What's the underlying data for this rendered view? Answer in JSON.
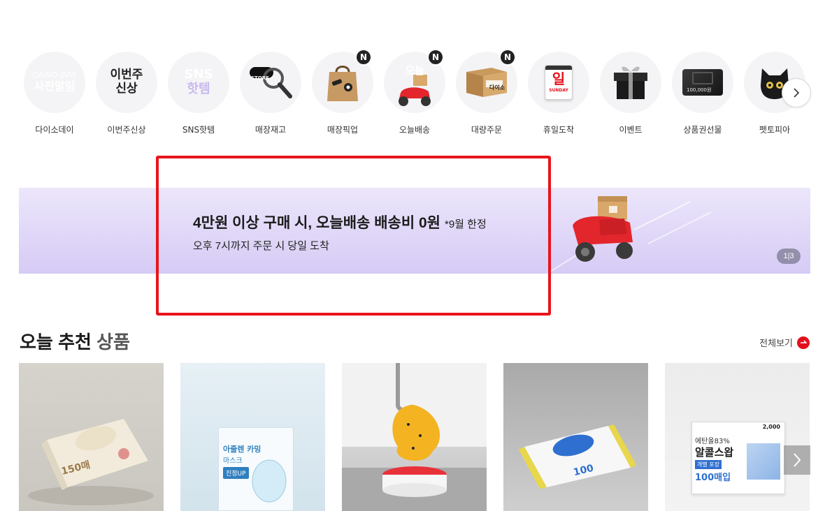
{
  "categories": [
    {
      "label": "다이소데이",
      "circle_line1": "DAISO-DAY",
      "circle_line2": "사전알림",
      "badge": ""
    },
    {
      "label": "이번주신상",
      "circle_line1": "이번주",
      "circle_line2": "신상",
      "badge": ""
    },
    {
      "label": "SNS핫템",
      "circle_line1": "SNS",
      "circle_line2": "핫템",
      "badge": ""
    },
    {
      "label": "매장재고",
      "circle_line1": "STORE",
      "icon": "magnifier-icon",
      "badge": ""
    },
    {
      "label": "매장픽업",
      "icon": "shopping-bag-icon",
      "badge": "N"
    },
    {
      "label": "오늘배송",
      "circle_line1": "오늘",
      "icon": "delivery-scooter-icon",
      "badge": "N"
    },
    {
      "label": "대량주문",
      "circle_line1": "다이소",
      "icon": "box-icon",
      "badge": "N"
    },
    {
      "label": "휴일도착",
      "circle_line1": "일",
      "circle_line2": "SUNDAY",
      "icon": "calendar-icon",
      "badge": ""
    },
    {
      "label": "이벤트",
      "icon": "gift-box-icon",
      "badge": ""
    },
    {
      "label": "상품권선물",
      "circle_line1": "100,000원",
      "icon": "gift-card-icon",
      "badge": ""
    },
    {
      "label": "펫토피아",
      "icon": "black-cat-icon",
      "badge": ""
    }
  ],
  "banner": {
    "title": "4만원 이상 구매 시, 오늘배송 배송비 0원",
    "note": "*9월 한정",
    "subtitle": "오후 7시까지 주문 시 당일 도착",
    "pager": "1|3"
  },
  "section": {
    "title_main": "오늘 추천",
    "title_accent": "상품",
    "view_all": "전체보기"
  },
  "products": [
    {
      "name": "wet-wipes-pack",
      "label_big": "150매"
    },
    {
      "name": "collagen-mask",
      "label_top": "아줄렌 카밍",
      "label_mid": "마스크",
      "label_btn": "진정UP"
    },
    {
      "name": "fly-trap",
      "label_big": ""
    },
    {
      "name": "wet-wipes-blue",
      "label_big": "100"
    },
    {
      "name": "alcohol-swab",
      "label_top": "에탄올83%",
      "label_mid": "알콜스왑",
      "label_btn": "개별 포장",
      "label_big": "100매입",
      "price": "2,000"
    }
  ],
  "colors": {
    "accent": "#e3101b",
    "highlight": "#e8141c",
    "banner_top": "#ece6fb",
    "banner_bottom": "#d6cbf5"
  }
}
